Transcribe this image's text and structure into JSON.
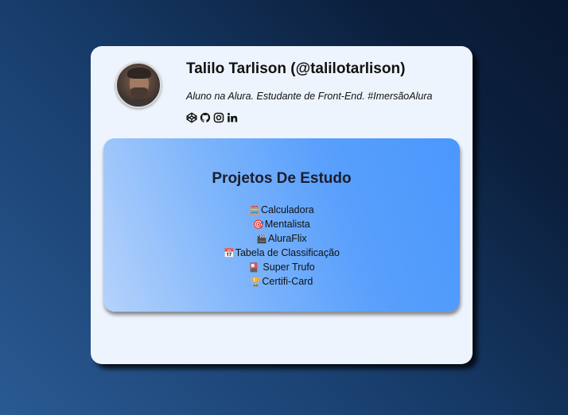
{
  "profile": {
    "name": "Talilo Tarlison (@talilotarlison)",
    "bio": "Aluno na Alura. Estudante de Front-End. #ImersãoAlura",
    "socials": [
      "codepen-icon",
      "github-icon",
      "instagram-icon",
      "linkedin-icon"
    ]
  },
  "projects": {
    "title": "Projetos De Estudo",
    "items": [
      {
        "emoji": "🧮",
        "label": "Calculadora"
      },
      {
        "emoji": "🎯",
        "label": "Mentalista"
      },
      {
        "emoji": "🎬",
        "label": "AluraFlix"
      },
      {
        "emoji": "📅",
        "label": "Tabela de Classificação"
      },
      {
        "emoji": "🎴",
        "label": " Super Trufo"
      },
      {
        "emoji": "🏆",
        "label": "Certifi-Card"
      }
    ]
  }
}
